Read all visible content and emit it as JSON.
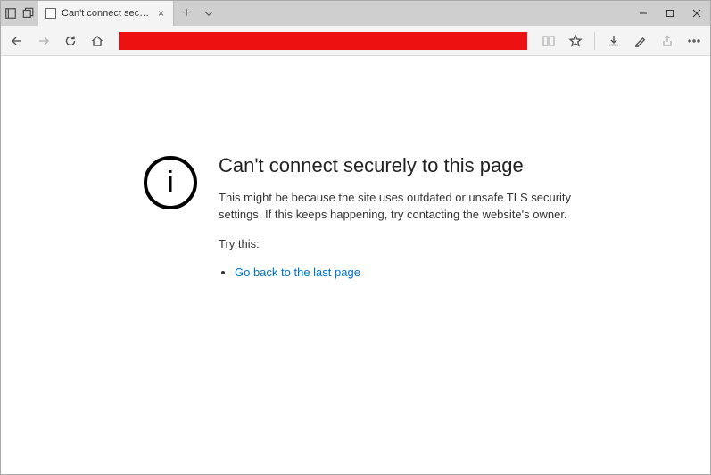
{
  "tab": {
    "title": "Can't connect securely t"
  },
  "error": {
    "heading": "Can't connect securely to this page",
    "message": "This might be because the site uses outdated or unsafe TLS security settings. If this keeps happening, try contacting the website's owner.",
    "try_label": "Try this:",
    "back_link": "Go back to the last page"
  },
  "colors": {
    "address_bar_fill": "#ee1111"
  }
}
